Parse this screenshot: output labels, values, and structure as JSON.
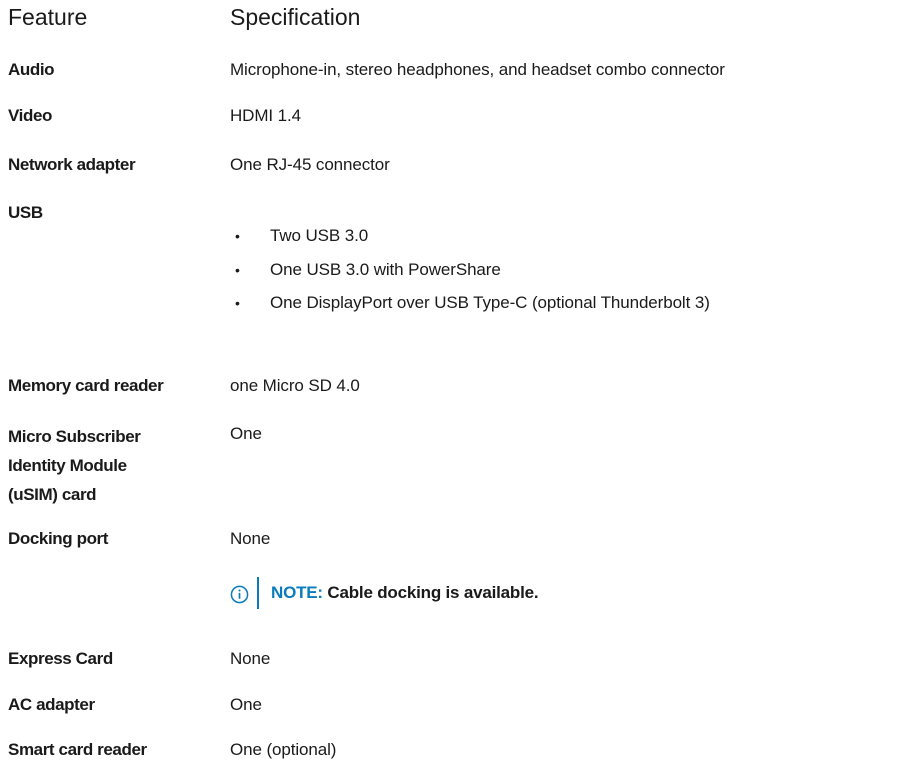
{
  "header": {
    "feature": "Feature",
    "specification": "Specification"
  },
  "rows": [
    {
      "feature": "Audio",
      "spec": "Microphone-in, stereo headphones, and headset combo connector"
    },
    {
      "feature": "Video",
      "spec": "HDMI 1.4"
    },
    {
      "feature": "Network adapter",
      "spec": "One RJ-45 connector"
    },
    {
      "feature": "USB",
      "bullets": [
        "Two USB 3.0",
        "One USB 3.0 with PowerShare",
        "One DisplayPort over USB Type-C (optional Thunderbolt 3)"
      ]
    },
    {
      "feature": "Memory card reader",
      "spec": "one Micro SD 4.0"
    },
    {
      "feature_lines": [
        "Micro Subscriber",
        "Identity Module",
        "(uSIM) card"
      ],
      "spec": "One"
    },
    {
      "feature": "Docking port",
      "spec": "None"
    },
    {
      "feature": "Express Card",
      "spec": "None"
    },
    {
      "feature": "AC adapter",
      "spec": "One"
    },
    {
      "feature": "Smart card reader",
      "spec": "One (optional)"
    }
  ],
  "note": {
    "icon": "info-icon",
    "label": "NOTE:",
    "text": " Cable docking is available.",
    "accent_color": "#0a7bbd"
  }
}
